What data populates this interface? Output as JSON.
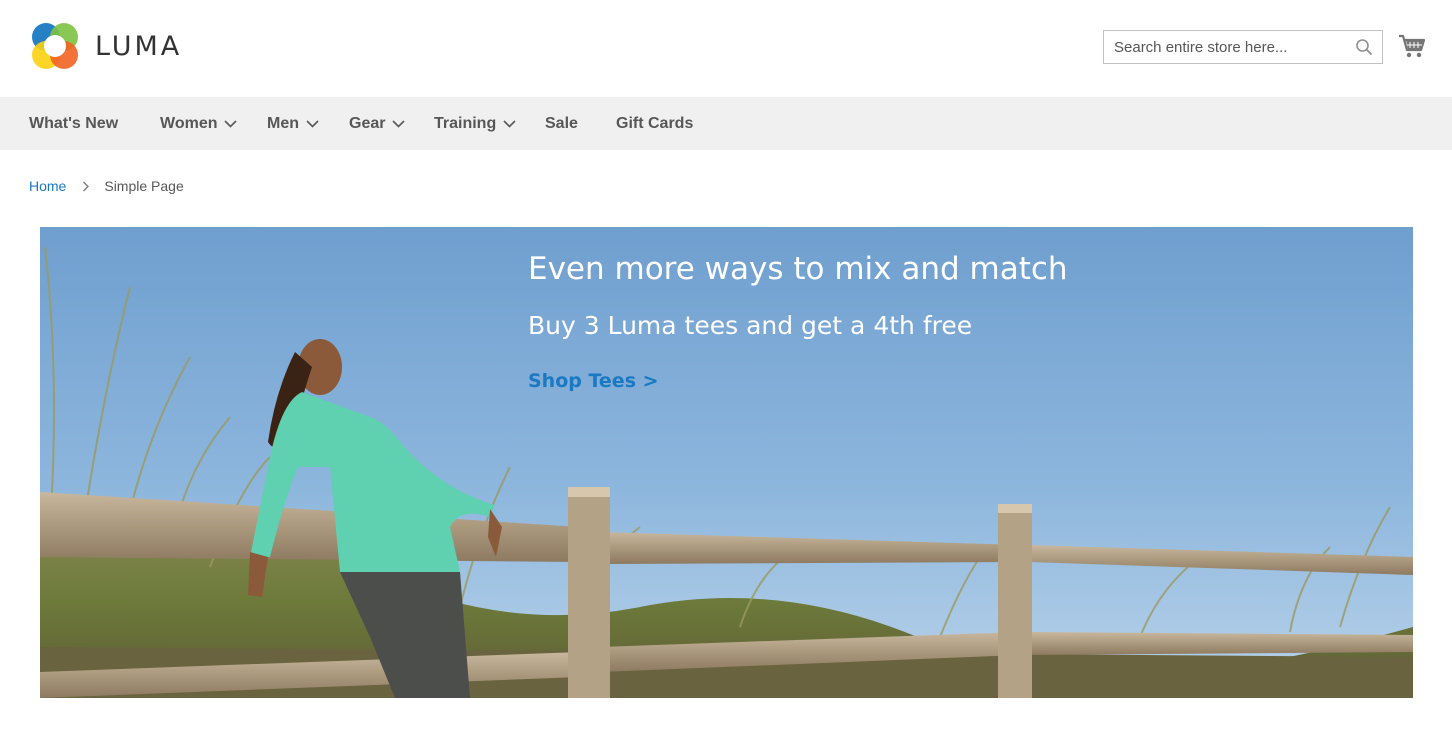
{
  "brand": {
    "name": "LUMA",
    "logo_colors": [
      "#f26322",
      "#1979c3",
      "#7cc242",
      "#fcd20e"
    ]
  },
  "search": {
    "placeholder": "Search entire store here..."
  },
  "nav": {
    "items": [
      {
        "label": "What's New",
        "has_dropdown": false
      },
      {
        "label": "Women",
        "has_dropdown": true
      },
      {
        "label": "Men",
        "has_dropdown": true
      },
      {
        "label": "Gear",
        "has_dropdown": true
      },
      {
        "label": "Training",
        "has_dropdown": true
      },
      {
        "label": "Sale",
        "has_dropdown": false
      },
      {
        "label": "Gift Cards",
        "has_dropdown": false
      }
    ]
  },
  "breadcrumb": {
    "home": "Home",
    "current": "Simple Page"
  },
  "hero": {
    "title": "Even more ways to mix and match",
    "subtitle": "Buy 3 Luma tees and get a 4th free",
    "cta": "Shop Tees >"
  },
  "icons": {
    "search": "search-icon",
    "cart": "cart-icon",
    "dropdown": "chevron-down-icon",
    "breadcrumb_sep": "chevron-right-icon"
  },
  "colors": {
    "link": "#1979c3",
    "nav_bg": "#f0f0f0",
    "text": "#575757"
  }
}
